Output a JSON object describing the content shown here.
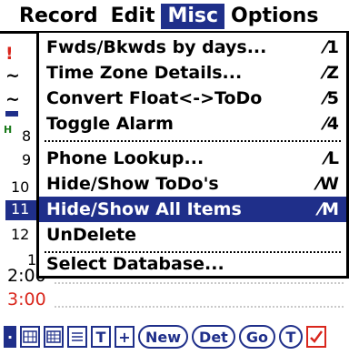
{
  "menubar": {
    "items": [
      {
        "label": "Record"
      },
      {
        "label": "Edit"
      },
      {
        "label": "Misc"
      },
      {
        "label": "Options"
      }
    ]
  },
  "misc_menu": {
    "items": [
      {
        "label": "Fwds/Bkwds by days...",
        "shortcut": "⁄1"
      },
      {
        "label": "Time Zone Details...",
        "shortcut": "⁄Z"
      },
      {
        "label": "Convert Float<->ToDo",
        "shortcut": "⁄5"
      },
      {
        "label": "Toggle Alarm",
        "shortcut": "⁄4"
      },
      {
        "label": "Phone Lookup...",
        "shortcut": "⁄L"
      },
      {
        "label": "Hide/Show ToDo's",
        "shortcut": "⁄W"
      },
      {
        "label": "Hide/Show All Items",
        "shortcut": "⁄M"
      },
      {
        "label": "UnDelete",
        "shortcut": ""
      },
      {
        "label": "Select Database...",
        "shortcut": ""
      }
    ]
  },
  "background": {
    "left_glyphs": [
      "!",
      "~",
      "~",
      "8",
      "9",
      "10",
      "11",
      "12",
      "1"
    ],
    "times": [
      {
        "label": "2:00",
        "color": "#000000"
      },
      {
        "label": "3:00",
        "color": "#d9261c"
      }
    ]
  },
  "toolbar": {
    "new_label": "New",
    "details_label": "Det",
    "goto_label": "Go",
    "t_label": "T"
  },
  "colors": {
    "accent": "#1f2f8a",
    "alert": "#d9261c"
  }
}
